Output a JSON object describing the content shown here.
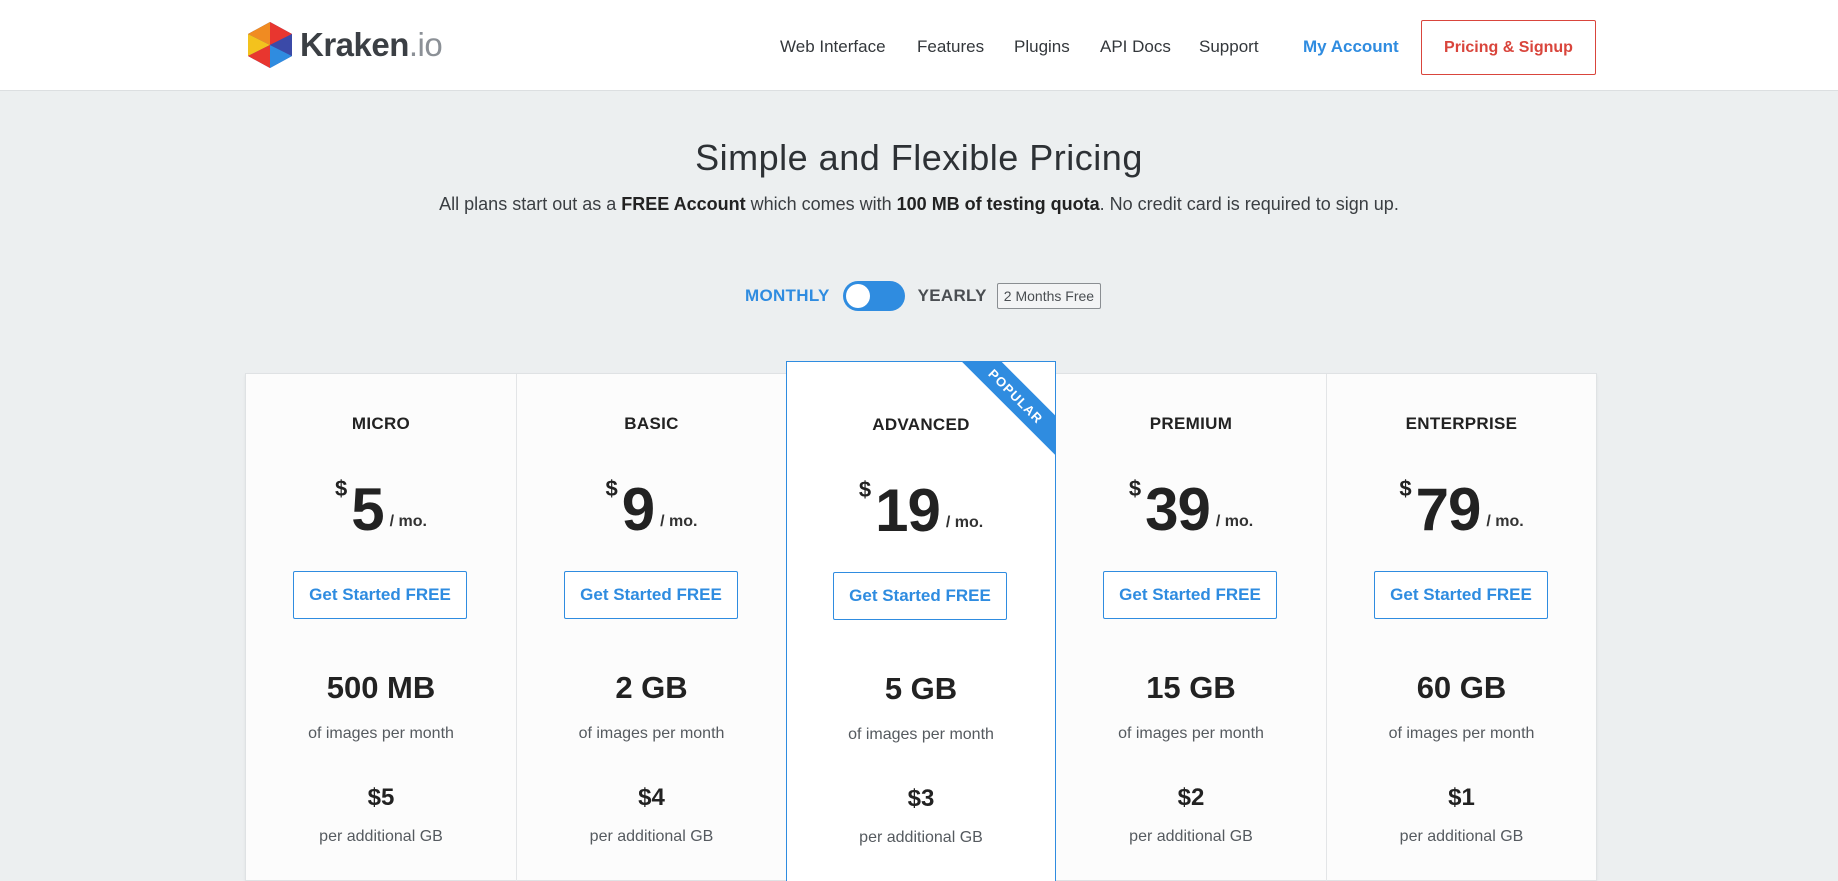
{
  "brand": {
    "name": "Kraken",
    "tld": ".io"
  },
  "nav": {
    "links": [
      "Web Interface",
      "Features",
      "Plugins",
      "API Docs",
      "Support"
    ],
    "account": "My Account",
    "signup": "Pricing & Signup"
  },
  "hero": {
    "title": "Simple and Flexible Pricing",
    "subtitle_parts": [
      "All plans start out as a ",
      "FREE Account",
      " which comes with ",
      "100 MB of testing quota",
      ". No credit card is required to sign up."
    ]
  },
  "billing": {
    "monthly": "MONTHLY",
    "yearly": "YEARLY",
    "badge": "2 Months Free",
    "selected": "monthly"
  },
  "plans": [
    {
      "name": "MICRO",
      "currency": "$",
      "price": "5",
      "unit": "/ mo.",
      "cta": "Get Started FREE",
      "quota": "500 MB",
      "quota_label": "of images per month",
      "extra": "$5",
      "extra_label": "per additional GB"
    },
    {
      "name": "BASIC",
      "currency": "$",
      "price": "9",
      "unit": "/ mo.",
      "cta": "Get Started FREE",
      "quota": "2 GB",
      "quota_label": "of images per month",
      "extra": "$4",
      "extra_label": "per additional GB"
    },
    {
      "name": "ADVANCED",
      "currency": "$",
      "price": "19",
      "unit": "/ mo.",
      "cta": "Get Started FREE",
      "quota": "5 GB",
      "quota_label": "of images per month",
      "extra": "$3",
      "extra_label": "per additional GB",
      "ribbon": "POPULAR"
    },
    {
      "name": "PREMIUM",
      "currency": "$",
      "price": "39",
      "unit": "/ mo.",
      "cta": "Get Started FREE",
      "quota": "15 GB",
      "quota_label": "of images per month",
      "extra": "$2",
      "extra_label": "per additional GB"
    },
    {
      "name": "ENTERPRISE",
      "currency": "$",
      "price": "79",
      "unit": "/ mo.",
      "cta": "Get Started FREE",
      "quota": "60 GB",
      "quota_label": "of images per month",
      "extra": "$1",
      "extra_label": "per additional GB"
    }
  ],
  "colors": {
    "accent": "#2f8ce0",
    "signup": "#d9453c",
    "background": "#eceff0"
  }
}
